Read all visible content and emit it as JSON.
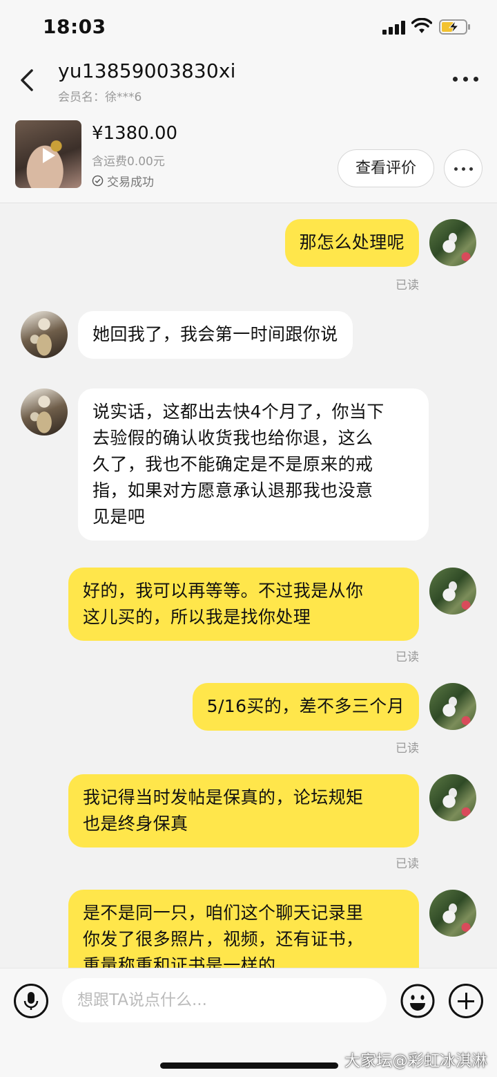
{
  "status_bar": {
    "time": "18:03"
  },
  "header": {
    "title": "yu13859003830xi",
    "subtitle": "会员名：徐***6"
  },
  "product": {
    "price": "¥1380.00",
    "shipping": "含运费0.00元",
    "status": "交易成功",
    "review_button": "查看评价"
  },
  "messages": [
    {
      "from": "self",
      "text": "那怎么处理呢",
      "read": "已读"
    },
    {
      "from": "other",
      "text": "她回我了，我会第一时间跟你说"
    },
    {
      "from": "other",
      "lines": [
        "说实话，这都出去快4个月了，你当下",
        "去验假的确认收货我也给你退，这么",
        "久了，我也不能确定是不是原来的戒",
        "指，如果对方愿意承认退那我也没意",
        "见是吧"
      ]
    },
    {
      "from": "self",
      "lines": [
        "好的，我可以再等等。不过我是从你",
        "这儿买的，所以我是找你处理"
      ],
      "read": "已读"
    },
    {
      "from": "self",
      "text": "5/16买的，差不多三个月",
      "read": "已读"
    },
    {
      "from": "self",
      "lines": [
        "我记得当时发帖是保真的，论坛规矩",
        "也是终身保真"
      ],
      "read": "已读"
    },
    {
      "from": "self",
      "lines": [
        "是不是同一只，咱们这个聊天记录里",
        "你发了很多照片，视频，还有证书，",
        "重量称重和证书是一样的"
      ]
    }
  ],
  "input": {
    "placeholder": "想跟TA说点什么..."
  },
  "watermark": "大家坛@彩虹冰淇淋",
  "colors": {
    "self_bubble": "#ffe64b",
    "other_bubble": "#ffffff",
    "background": "#f2f2f2"
  }
}
